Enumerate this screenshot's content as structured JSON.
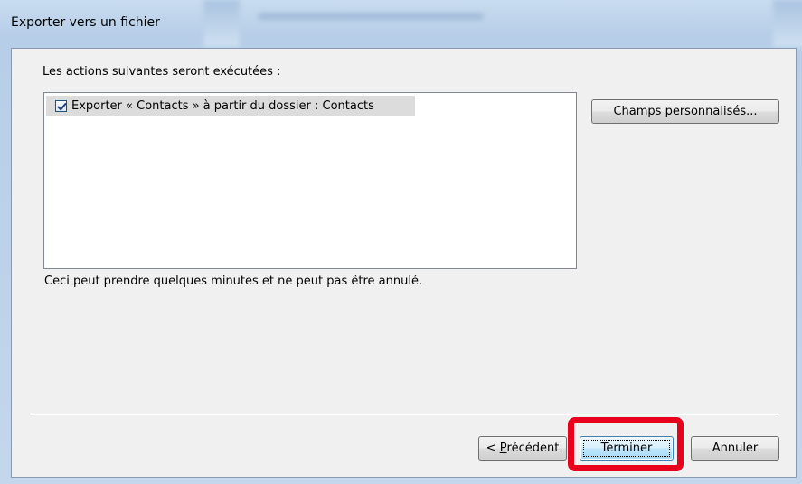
{
  "window": {
    "title": "Exporter vers un fichier"
  },
  "content": {
    "actions_label": "Les actions suivantes seront exécutées :",
    "actions": [
      {
        "label": "Exporter « Contacts » à partir du dossier : Contacts",
        "checked": true
      }
    ],
    "note": "Ceci peut prendre quelques minutes et ne peut pas être annulé."
  },
  "buttons": {
    "custom_fields": {
      "accel": "C",
      "rest": "hamps personnalisés..."
    },
    "previous": {
      "prefix": "< ",
      "accel": "P",
      "rest": "récédent"
    },
    "finish": "Terminer",
    "cancel": "Annuler"
  },
  "colors": {
    "highlight": "#e8001c",
    "title_bar": "#b7cee8",
    "dialog_bg": "#f0f0f0"
  }
}
